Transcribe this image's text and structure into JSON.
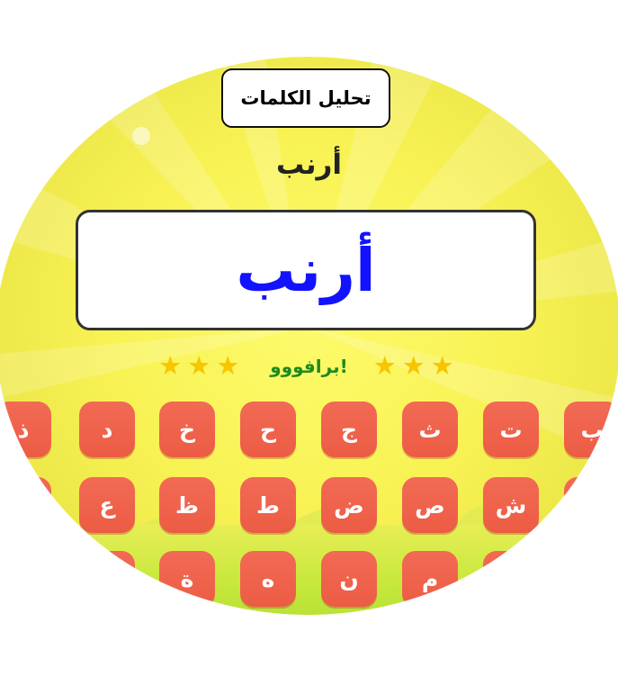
{
  "header": {
    "title": "تحليل الكلمات"
  },
  "word": {
    "label": "أرنب",
    "answer": "أرنب"
  },
  "feedback": {
    "text": "!برافووو",
    "stars_left": "★★★",
    "stars_right": "★★★"
  },
  "keyboard": {
    "row1": [
      "ذ",
      "د",
      "خ",
      "ح",
      "ج",
      "ث",
      "ت",
      "ب"
    ],
    "row2": [
      "",
      "ع",
      "ظ",
      "ط",
      "ض",
      "ص",
      "ش",
      ""
    ],
    "row3": [
      "",
      "",
      "ة",
      "ه",
      "ن",
      "م",
      "",
      ""
    ]
  },
  "colors": {
    "background": "#f8f254",
    "key": "#ec5c44",
    "answer_text": "#1212ff",
    "bravo": "#1f8a1f",
    "star": "#f7c600"
  }
}
